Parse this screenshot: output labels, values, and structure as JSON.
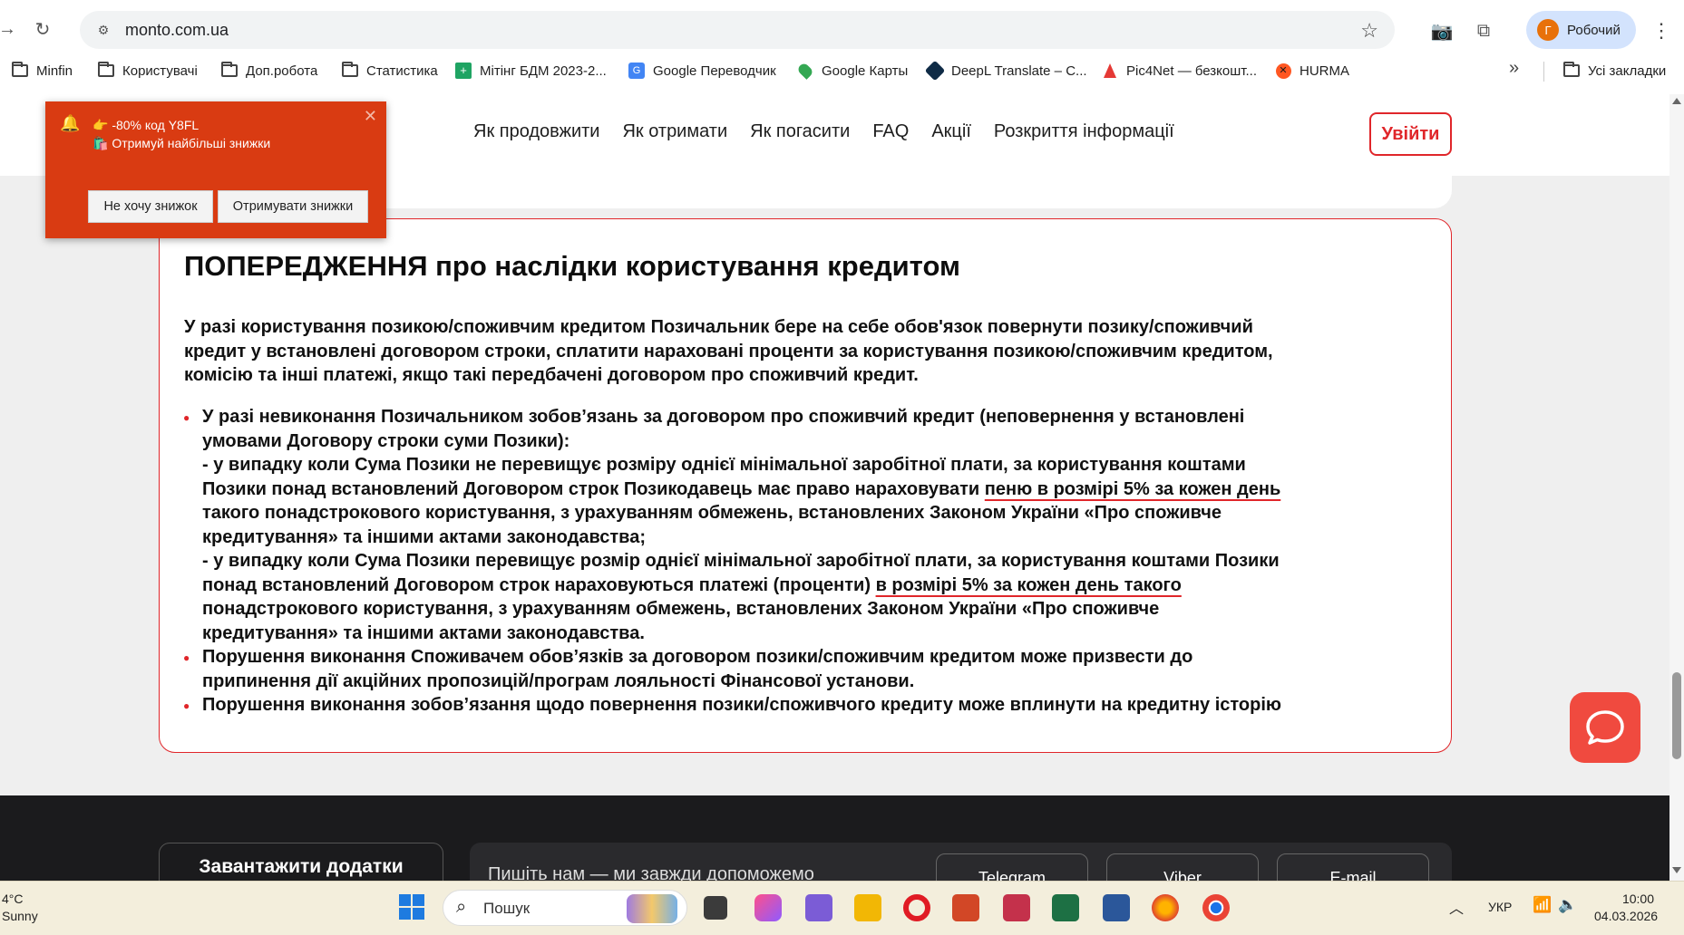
{
  "browser": {
    "url": "monto.com.ua",
    "profile_label": "Робочий",
    "profile_initial": "Г",
    "bookmarks": [
      {
        "label": "Minfin",
        "icon": "folder-icon"
      },
      {
        "label": "Користувачі",
        "icon": "folder-icon"
      },
      {
        "label": "Доп.робота",
        "icon": "folder-icon"
      },
      {
        "label": "Статистика",
        "icon": "folder-icon"
      },
      {
        "label": "Мітінг БДМ 2023-2...",
        "icon": "sheets-icon"
      },
      {
        "label": "Google Переводчик",
        "icon": "translate-icon"
      },
      {
        "label": "Google Карты",
        "icon": "maps-icon"
      },
      {
        "label": "DeepL Translate – С...",
        "icon": "deepl-icon"
      },
      {
        "label": "Pic4Net — безкошт...",
        "icon": "pic4net-icon"
      },
      {
        "label": "HURMA",
        "icon": "hurma-icon"
      }
    ],
    "all_bookmarks_label": "Усі закладки"
  },
  "site": {
    "nav": [
      "Як продовжити",
      "Як отримати",
      "Як погасити",
      "FAQ",
      "Акції",
      "Розкриття інформації"
    ],
    "login_label": "Увійти"
  },
  "warning": {
    "title": "ПОПЕРЕДЖЕННЯ про наслідки користування кредитом",
    "intro": [
      "У разі користування позикою/споживчим кредитом Позичальник бере на себе обов'язок повернути позику/споживчий",
      "кредит у встановлені договором строки, сплатити нараховані проценти за користування позикою/споживчим кредитом,",
      "комісію та інші платежі, якщо такі передбачені договором про споживчий кредит."
    ],
    "item1": {
      "l1": "У разі невиконання Позичальником зобов’язань за договором про споживчий кредит (неповернення у встановлені",
      "l2": "умовами Договору строки суми Позики):",
      "l3": "- у випадку коли Сума Позики не перевищує розміру однієї мінімальної заробітної плати, за користування коштами",
      "l4a": "Позики понад встановлений Договором строк Позикодавець має право нараховувати ",
      "l4b": "пеню в розмірі 5% за кожен день",
      "l5": "такого понадстрокового користування, з урахуванням обмежень, встановлених Законом України «Про споживче",
      "l6": "кредитування» та іншими актами законодавства;",
      "l7": "- у випадку коли Сума Позики перевищує розмір однієї мінімальної заробітної плати, за користування коштами Позики",
      "l8a": "понад встановлений Договором строк нараховуються платежі (проценти) ",
      "l8b": "в розмірі 5% за кожен день такого",
      "l9": "понадстрокового користування, з урахуванням обмежень, встановлених Законом України «Про споживче",
      "l10": "кредитування» та іншими актами законодавства."
    },
    "item2": {
      "l1": "Порушення виконання Споживачем обов’язків за договором позики/споживчим кредитом може призвести до",
      "l2": "припинення дії акційних пропозицій/програм лояльності Фінансової установи."
    },
    "item3": {
      "l1": "Порушення виконання зобов’язання щодо повернення позики/споживчого кредиту може вплинути на кредитну історію"
    }
  },
  "footer": {
    "apps_label": "Завантажити додатки",
    "contact_text": "Пишіть нам — ми завжди допоможемо",
    "socials": [
      "Telegram",
      "Viber",
      "E-mail"
    ]
  },
  "promo": {
    "line1": "👉 -80% код Y8FL",
    "line2": "🛍️ Отримуй найбільші знижки",
    "decline_label": "Не хочу знижок",
    "accept_label": "Отримувати знижки"
  },
  "taskbar": {
    "temperature": "4°C",
    "weather": "Sunny",
    "search_placeholder": "Пошук",
    "language": "УКР",
    "time": "10:00",
    "date": "04.03.2026"
  },
  "colors": {
    "accent_red": "#e0262a",
    "promo_bg": "#d93b12",
    "footer_bg": "#1b1b1d",
    "chat_btn": "#f04a3f"
  }
}
